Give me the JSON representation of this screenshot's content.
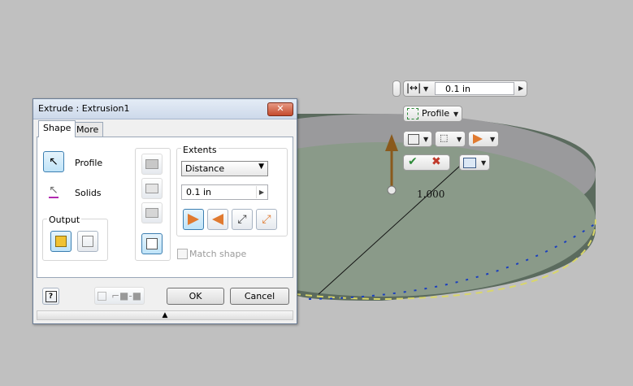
{
  "dialog": {
    "title": "Extrude : Extrusion1",
    "close": "✕",
    "tabs": [
      "Shape",
      "More"
    ],
    "profile_label": "Profile",
    "solids_label": "Solids",
    "output_label": "Output",
    "extents_label": "Extents",
    "extents_type": "Distance",
    "distance_value": "0.1 in",
    "match_shape_label": "Match shape",
    "ok_label": "OK",
    "cancel_label": "Cancel",
    "help_label": "?",
    "expand_arrow": "▲"
  },
  "minitoolbar": {
    "distance_value": "0.1 in",
    "profile_label": "Profile"
  },
  "viewport": {
    "dimension_label": "1.000"
  },
  "colors": {
    "accent": "#3c7fb1",
    "arrow": "#8a5a1c",
    "cylinder_top": "#8c9b8a",
    "cylinder_side": "#5a6a5c",
    "cancel_red": "#c0392b",
    "ok_green": "#2e8b3a"
  }
}
